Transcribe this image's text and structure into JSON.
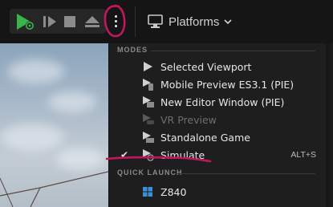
{
  "toolbar": {
    "play_icon": "play-icon",
    "frame_skip_icon": "frame-skip-icon",
    "stop_icon": "stop-icon",
    "eject_icon": "eject-icon",
    "more_options_icon": "vertical-ellipsis-icon",
    "platforms_label": "Platforms",
    "accent_green": "#39b54a",
    "annotation_color": "#c2185b"
  },
  "menu": {
    "modes_header": "MODES",
    "items": [
      {
        "label": "Selected Viewport",
        "icon": "play-triangle-icon",
        "checked": false,
        "enabled": true,
        "shortcut": ""
      },
      {
        "label": "Mobile Preview ES3.1 (PIE)",
        "icon": "mobile-preview-icon",
        "checked": false,
        "enabled": true,
        "shortcut": ""
      },
      {
        "label": "New Editor Window (PIE)",
        "icon": "new-window-icon",
        "checked": false,
        "enabled": true,
        "shortcut": ""
      },
      {
        "label": "VR Preview",
        "icon": "vr-preview-icon",
        "checked": false,
        "enabled": false,
        "shortcut": ""
      },
      {
        "label": "Standalone Game",
        "icon": "standalone-game-icon",
        "checked": false,
        "enabled": true,
        "shortcut": ""
      },
      {
        "label": "Simulate",
        "icon": "simulate-icon",
        "checked": true,
        "enabled": true,
        "shortcut": "ALT+S"
      }
    ],
    "quick_launch_header": "QUICK LAUNCH",
    "quick_launch_items": [
      {
        "label": "Z840",
        "icon": "windows-device-icon"
      }
    ],
    "check_glyph": "✔"
  }
}
